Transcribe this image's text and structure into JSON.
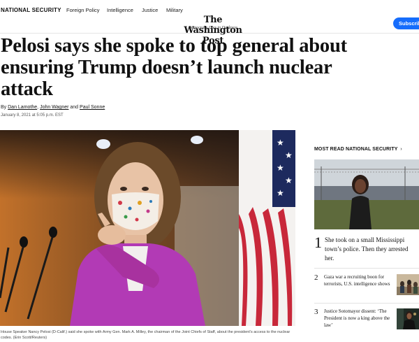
{
  "header": {
    "section": "NATIONAL SECURITY",
    "nav": [
      "Foreign Policy",
      "Intelligence",
      "Justice",
      "Military"
    ],
    "brand": "The Washington Post",
    "tagline": "Democracy Dies in Darkness",
    "subscribe": "Subscribe"
  },
  "article": {
    "headline": "Pelosi says she spoke to top general about ensuring Trump doesn’t launch nuclear attack",
    "byline_prefix": "By",
    "authors": [
      "Dan Lamothe",
      "John Wagner",
      "Paul Sonne"
    ],
    "byline_sep1": ",",
    "byline_and": "and",
    "timestamp": "January 8, 2021 at 5:05 p.m. EST",
    "caption": "House Speaker Nancy Pelosi (D-Calif.) said she spoke with Army Gen. Mark A. Milley, the chairman of the Joint Chiefs of Staff, about the president’s access to the nuclear codes. (Erin Scott/Reuters)"
  },
  "sidebar": {
    "title": "MOST READ NATIONAL SECURITY",
    "chevron": "›",
    "items": [
      {
        "num": "1",
        "text": "She took on a small Mississippi town’s police. Then they arrested her."
      },
      {
        "num": "2",
        "text": "Gaza war a recruiting boon for terrorists, U.S. intelligence shows"
      },
      {
        "num": "3",
        "text": "Justice Sotomayor dissent: ‘The President is now a king above the law’"
      }
    ]
  },
  "colors": {
    "subscribe_bg": "#166dfc",
    "photo_blazer": "#b23ab5"
  }
}
